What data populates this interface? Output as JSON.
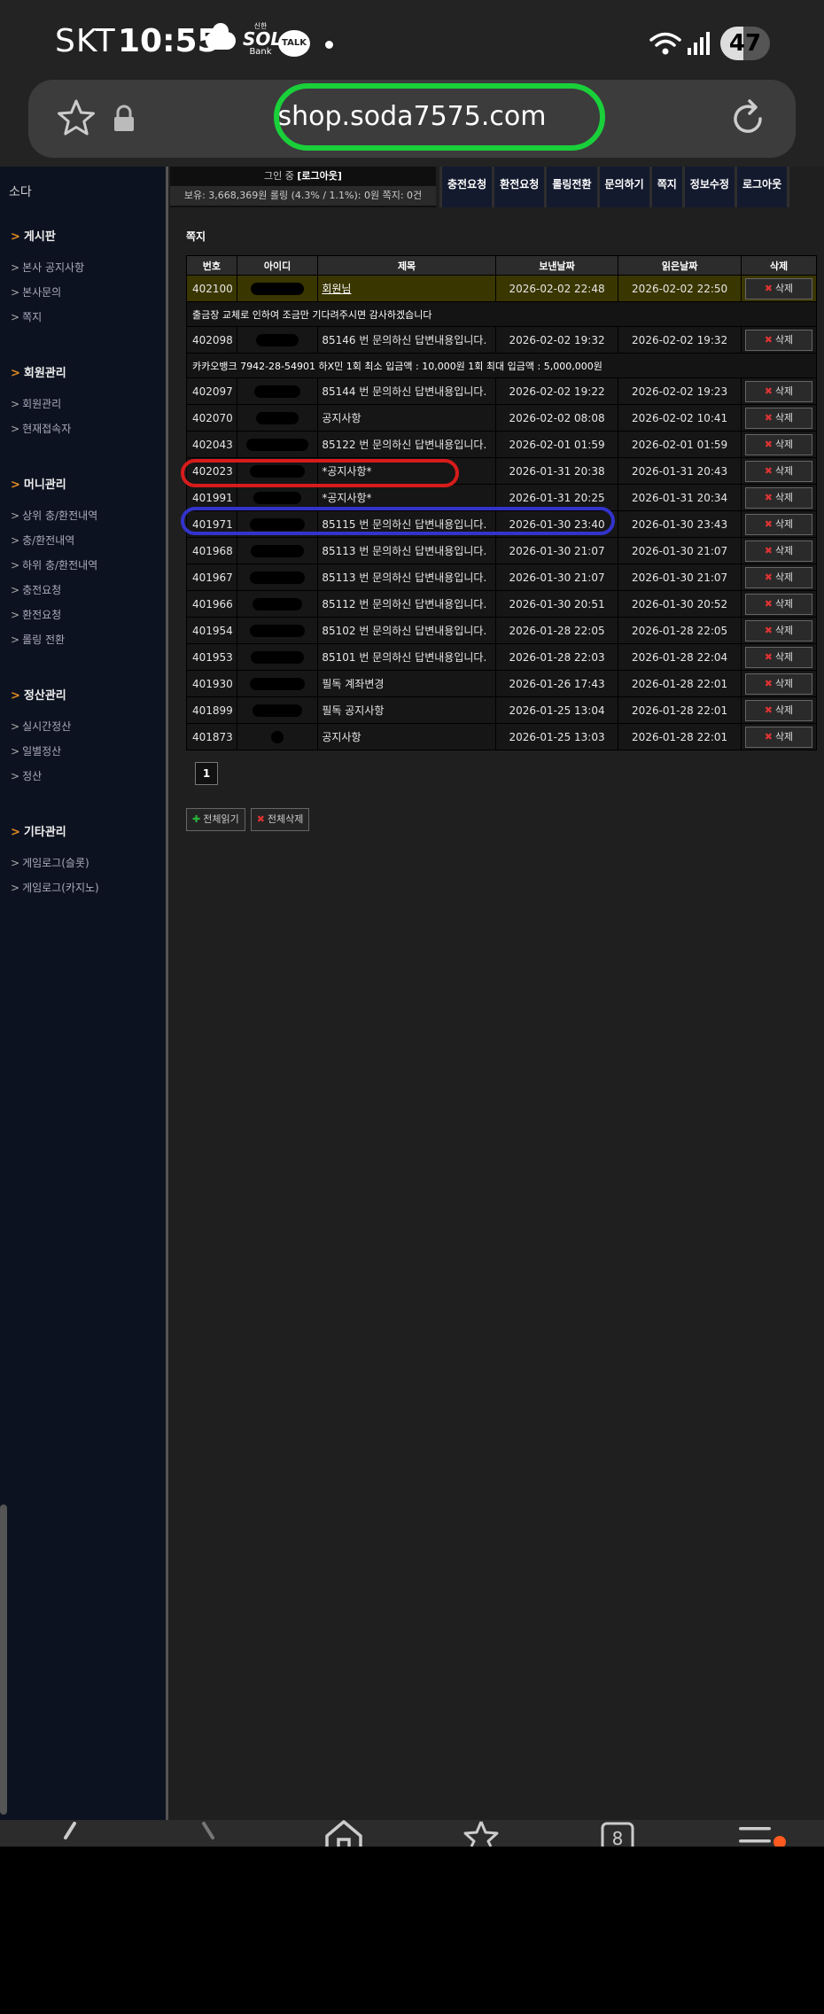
{
  "status_bar": {
    "carrier": "SKT",
    "time": "10:55",
    "sol_top": "신한",
    "sol_main": "SOL",
    "sol_bottom": "Bank",
    "talk": "TALK",
    "battery": 47
  },
  "browser": {
    "url": "shop.soda7575.com",
    "highlight_color": "#19d03a"
  },
  "sidebar": {
    "brand": "소다",
    "groups": [
      {
        "title": "게시판",
        "items": [
          "본사 공지사항",
          "본사문의",
          "쪽지"
        ]
      },
      {
        "title": "회원관리",
        "items": [
          "회원관리",
          "현재접속자"
        ]
      },
      {
        "title": "머니관리",
        "items": [
          "상위 충/환전내역",
          "충/환전내역",
          "하위 충/환전내역",
          "충전요청",
          "환전요청",
          "롤링 전환"
        ]
      },
      {
        "title": "정산관리",
        "items": [
          "실시간정산",
          "일별정산",
          "정산"
        ]
      },
      {
        "title": "기타관리",
        "items": [
          "게임로그(슬롯)",
          "게임로그(카지노)"
        ]
      }
    ]
  },
  "topinfo": {
    "login_prefix": "그인 중",
    "logout_link": "[로그아웃]",
    "balance_line": "보유: 3,668,369원 롤링 (4.3% / 1.1%): 0원 쪽지: 0건"
  },
  "topnav": [
    "충전요청",
    "환전요청",
    "롤링전환",
    "문의하기",
    "쪽지",
    "정보수정",
    "로그아웃"
  ],
  "section_title": "쪽지",
  "table": {
    "headers": [
      "번호",
      "아이디",
      "제목",
      "보낸날짜",
      "읽은날짜",
      "삭제"
    ],
    "delete_label": "삭제",
    "rows": [
      {
        "no": "402100",
        "subject": "회원님",
        "sent": "2026-02-02 22:48",
        "read": "2026-02-02 22:50",
        "highlight": true,
        "link": true,
        "detail": "출금장 교체로 인하여 조금만 기다려주시면 감사하겠습니다"
      },
      {
        "no": "402098",
        "subject": "85146 번 문의하신 답변내용입니다.",
        "sent": "2026-02-02 19:32",
        "read": "2026-02-02 19:32",
        "detail": "카카오뱅크 7942-28-54901 하X민 1회 최소 입금액 : 10,000원 1회 최대 입금액 : 5,000,000원"
      },
      {
        "no": "402097",
        "subject": "85144 번 문의하신 답변내용입니다.",
        "sent": "2026-02-02 19:22",
        "read": "2026-02-02 19:23"
      },
      {
        "no": "402070",
        "subject": "공지사항",
        "sent": "2026-02-02 08:08",
        "read": "2026-02-02 10:41"
      },
      {
        "no": "402043",
        "subject": "85122 번 문의하신 답변내용입니다.",
        "sent": "2026-02-01 01:59",
        "read": "2026-02-01 01:59"
      },
      {
        "no": "402023",
        "subject": "*공지사항*",
        "sent": "2026-01-31 20:38",
        "read": "2026-01-31 20:43"
      },
      {
        "no": "401991",
        "subject": "*공지사항*",
        "sent": "2026-01-31 20:25",
        "read": "2026-01-31 20:34"
      },
      {
        "no": "401971",
        "subject": "85115 번 문의하신 답변내용입니다.",
        "sent": "2026-01-30 23:40",
        "read": "2026-01-30 23:43"
      },
      {
        "no": "401968",
        "subject": "85113 번 문의하신 답변내용입니다.",
        "sent": "2026-01-30 21:07",
        "read": "2026-01-30 21:07"
      },
      {
        "no": "401967",
        "subject": "85113 번 문의하신 답변내용입니다.",
        "sent": "2026-01-30 21:07",
        "read": "2026-01-30 21:07"
      },
      {
        "no": "401966",
        "subject": "85112 번 문의하신 답변내용입니다.",
        "sent": "2026-01-30 20:51",
        "read": "2026-01-30 20:52"
      },
      {
        "no": "401954",
        "subject": "85102 번 문의하신 답변내용입니다.",
        "sent": "2026-01-28 22:05",
        "read": "2026-01-28 22:05"
      },
      {
        "no": "401953",
        "subject": "85101 번 문의하신 답변내용입니다.",
        "sent": "2026-01-28 22:03",
        "read": "2026-01-28 22:04"
      },
      {
        "no": "401930",
        "subject": "필독 계좌변경",
        "sent": "2026-01-26 17:43",
        "read": "2026-01-28 22:01"
      },
      {
        "no": "401899",
        "subject": "필독 공지사항",
        "sent": "2026-01-25 13:04",
        "read": "2026-01-28 22:01"
      },
      {
        "no": "401873",
        "subject": "공지사항",
        "sent": "2026-01-25 13:03",
        "read": "2026-01-28 22:01"
      }
    ]
  },
  "pagination": {
    "current": "1"
  },
  "actions": {
    "read_all": "전체읽기",
    "delete_all": "전체삭제"
  },
  "annotations": {
    "red": "#d81b1b",
    "blue": "#3333cc"
  },
  "bottom_toolbar": {
    "tabs_count": "8",
    "notification_color": "#ff5a1f"
  }
}
